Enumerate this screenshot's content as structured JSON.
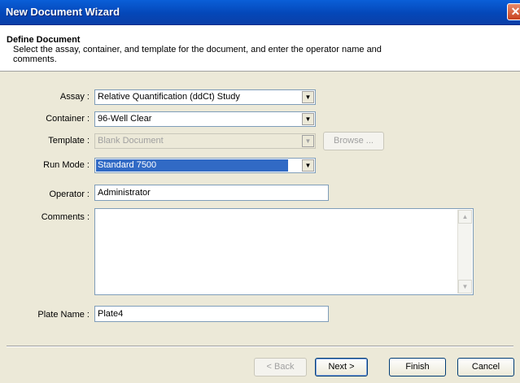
{
  "window": {
    "title": "New Document Wizard",
    "close_glyph": "✕"
  },
  "header": {
    "title": "Define Document",
    "description": "Select the assay, container, and template for the document, and enter the operator name and comments."
  },
  "form": {
    "assay": {
      "label": "Assay :",
      "value": "Relative Quantification (ddCt) Study"
    },
    "container": {
      "label": "Container :",
      "value": "96-Well Clear"
    },
    "template": {
      "label": "Template :",
      "value": "Blank Document",
      "browse_label": "Browse ..."
    },
    "run_mode": {
      "label": "Run Mode :",
      "value": "Standard 7500"
    },
    "operator": {
      "label": "Operator :",
      "value": "Administrator"
    },
    "comments": {
      "label": "Comments :",
      "value": ""
    },
    "plate_name": {
      "label": "Plate Name :",
      "value": "Plate4"
    }
  },
  "buttons": {
    "back": "< Back",
    "next": "Next >",
    "finish": "Finish",
    "cancel": "Cancel"
  },
  "icons": {
    "dropdown": "chevron-down-icon",
    "close": "close-icon"
  }
}
